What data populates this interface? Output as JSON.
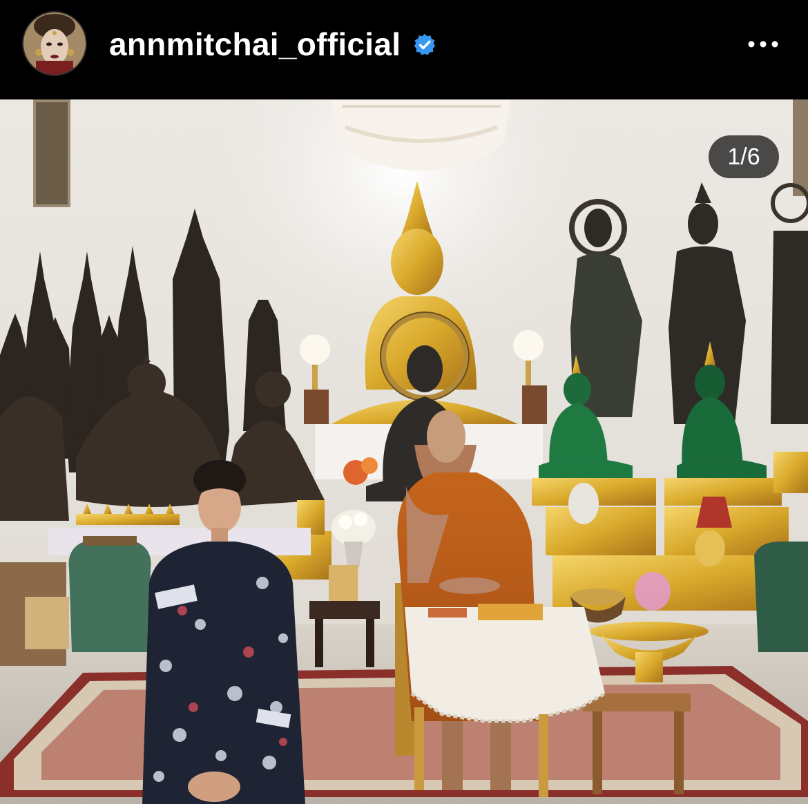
{
  "post": {
    "username": "annmitchai_official",
    "verified": true,
    "more_icon": "more-horizontal-icon",
    "avatar_icon": "profile-avatar",
    "carousel_counter": "1/6"
  },
  "colors": {
    "background": "#000000",
    "verified_badge": "#3897F0",
    "counter_bg": "#262626"
  },
  "photo": {
    "scene": "temple-shrine",
    "subjects": [
      "woman-seated-front",
      "monk-in-orange-robe"
    ]
  }
}
